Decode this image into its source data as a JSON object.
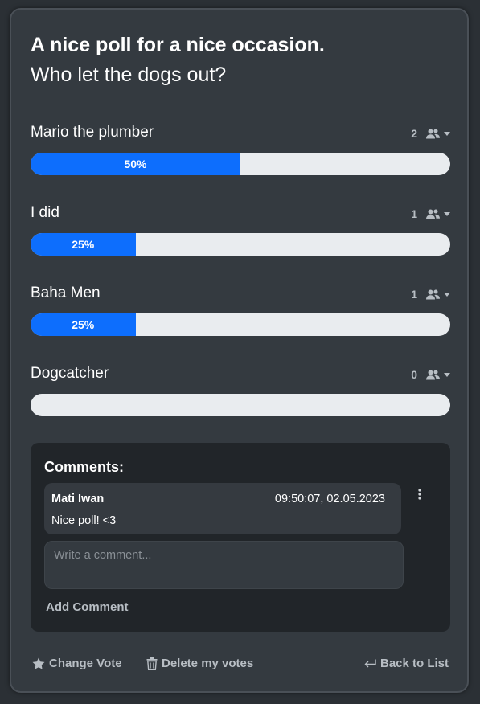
{
  "poll": {
    "title_line1": "A nice poll for a nice occasion.",
    "title_line2": "Who let the dogs out?"
  },
  "options": [
    {
      "label": "Mario the plumber",
      "votes": "2",
      "percent": 50,
      "percent_label": "50%"
    },
    {
      "label": "I did",
      "votes": "1",
      "percent": 25,
      "percent_label": "25%"
    },
    {
      "label": "Baha Men",
      "votes": "1",
      "percent": 25,
      "percent_label": "25%"
    },
    {
      "label": "Dogcatcher",
      "votes": "0",
      "percent": 0,
      "percent_label": ""
    }
  ],
  "comments": {
    "heading": "Comments:",
    "items": [
      {
        "author": "Mati Iwan",
        "time": "09:50:07, 02.05.2023",
        "text": "Nice poll! <3"
      }
    ],
    "input_placeholder": "Write a comment...",
    "add_label": "Add Comment"
  },
  "footer": {
    "change_vote": "Change Vote",
    "delete_votes": "Delete my votes",
    "back_to_list": "Back to List"
  },
  "colors": {
    "accent": "#0d6efd",
    "card": "#343a40",
    "track": "#e9ecef",
    "muted": "#b8bec4"
  },
  "icons": {
    "votes": "people-icon",
    "dropdown": "caret-down-icon",
    "change_vote": "star-icon",
    "delete": "trash-icon",
    "back": "return-arrow-icon",
    "comment_menu": "kebab-menu-icon"
  }
}
